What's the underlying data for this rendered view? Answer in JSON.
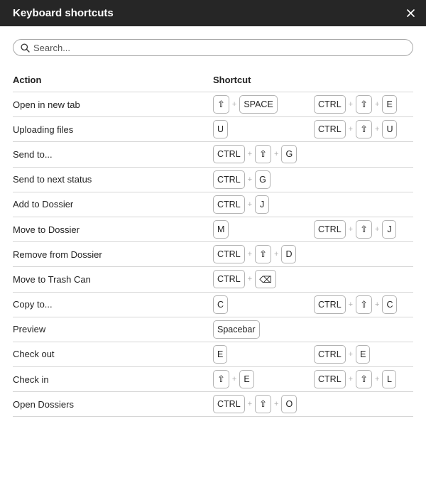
{
  "dialog": {
    "title": "Keyboard shortcuts",
    "close_icon": "close-icon"
  },
  "search": {
    "placeholder": "Search...",
    "value": "",
    "icon": "search-icon"
  },
  "table": {
    "headers": {
      "action": "Action",
      "shortcut": "Shortcut"
    },
    "rows": [
      {
        "action": "Open in new tab",
        "shortcuts": [
          [
            "⇧",
            "SPACE"
          ],
          [
            "CTRL",
            "⇧",
            "E"
          ]
        ]
      },
      {
        "action": "Uploading files",
        "shortcuts": [
          [
            "U"
          ],
          [
            "CTRL",
            "⇧",
            "U"
          ]
        ]
      },
      {
        "action": "Send to...",
        "shortcuts": [
          [
            "CTRL",
            "⇧",
            "G"
          ]
        ]
      },
      {
        "action": "Send to next status",
        "shortcuts": [
          [
            "CTRL",
            "G"
          ]
        ]
      },
      {
        "action": "Add to Dossier",
        "shortcuts": [
          [
            "CTRL",
            "J"
          ]
        ]
      },
      {
        "action": "Move to Dossier",
        "shortcuts": [
          [
            "M"
          ],
          [
            "CTRL",
            "⇧",
            "J"
          ]
        ]
      },
      {
        "action": "Remove from Dossier",
        "shortcuts": [
          [
            "CTRL",
            "⇧",
            "D"
          ]
        ]
      },
      {
        "action": "Move to Trash Can",
        "shortcuts": [
          [
            "CTRL",
            "⌫"
          ]
        ]
      },
      {
        "action": "Copy to...",
        "shortcuts": [
          [
            "C"
          ],
          [
            "CTRL",
            "⇧",
            "C"
          ]
        ]
      },
      {
        "action": "Preview",
        "shortcuts": [
          [
            "Spacebar"
          ]
        ]
      },
      {
        "action": "Check out",
        "shortcuts": [
          [
            "E"
          ],
          [
            "CTRL",
            "E"
          ]
        ]
      },
      {
        "action": "Check in",
        "shortcuts": [
          [
            "⇧",
            "E"
          ],
          [
            "CTRL",
            "⇧",
            "L"
          ]
        ]
      },
      {
        "action": "Open Dossiers",
        "shortcuts": [
          [
            "CTRL",
            "⇧",
            "O"
          ]
        ]
      }
    ],
    "separator": "+"
  }
}
